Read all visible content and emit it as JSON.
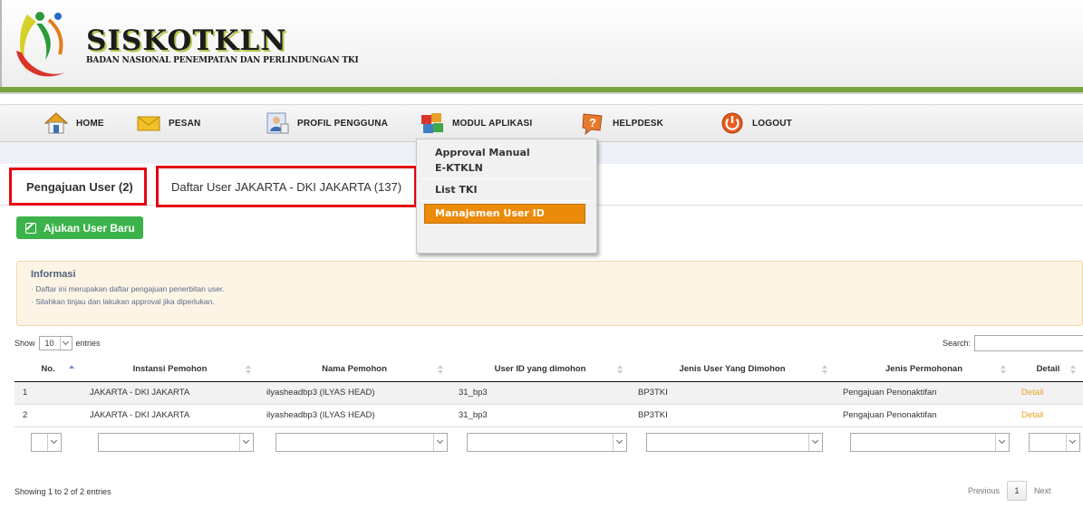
{
  "brand": {
    "title": "SISKOTKLN",
    "subtitle": "BADAN NASIONAL PENEMPATAN DAN PERLINDUNGAN TKI"
  },
  "nav": {
    "items": [
      {
        "label": "HOME",
        "icon": "home-icon"
      },
      {
        "label": "PESAN",
        "icon": "envelope-icon"
      },
      {
        "label": "PROFIL PENGGUNA",
        "icon": "profile-icon"
      },
      {
        "label": "MODUL APLIKASI",
        "icon": "modules-icon"
      },
      {
        "label": "HELPDESK",
        "icon": "help-icon"
      },
      {
        "label": "LOGOUT",
        "icon": "power-icon"
      }
    ]
  },
  "dropdown": {
    "items": [
      "Approval Manual",
      "E-KTKLN",
      "List TKI",
      "Manajemen User ID"
    ]
  },
  "tabs": {
    "active": "Pengajuan User (2)",
    "second": "Daftar User JAKARTA - DKI JAKARTA (137)"
  },
  "actions": {
    "add_user": "Ajukan User Baru"
  },
  "info": {
    "title": "Informasi",
    "lines": [
      "Daftar ini merupakan daftar pengajuan penerbitan user.",
      "Silahkan tinjau dan lakukan approval jika diperlukan."
    ]
  },
  "table_controls": {
    "show_label": "Show",
    "entries_value": "10",
    "entries_label": "entries",
    "search_label": "Search:"
  },
  "table": {
    "headers": [
      "No.",
      "Instansi Pemohon",
      "Nama Pemohon",
      "User ID yang dimohon",
      "Jenis User Yang Dimohon",
      "Jenis Permohonan",
      "Detail"
    ],
    "rows": [
      [
        "1",
        "JAKARTA - DKI JAKARTA",
        "ilyasheadbp3 (ILYAS HEAD)",
        "31_bp3",
        "BP3TKI",
        "Pengajuan Penonaktifan",
        "Detail"
      ],
      [
        "2",
        "JAKARTA - DKI JAKARTA",
        "ilyasheadbp3 (ILYAS HEAD)",
        "31_bp3",
        "BP3TKI",
        "Pengajuan Penonaktifan",
        "Detail"
      ]
    ]
  },
  "footer": {
    "showing": "Showing 1 to 2 of 2 entries",
    "previous": "Previous",
    "page": "1",
    "next": "Next"
  },
  "colors": {
    "accent_green": "#3cb34a",
    "header_line": "#76a640",
    "highlight_red": "#e30613",
    "menu_active": "#ec8a09"
  }
}
